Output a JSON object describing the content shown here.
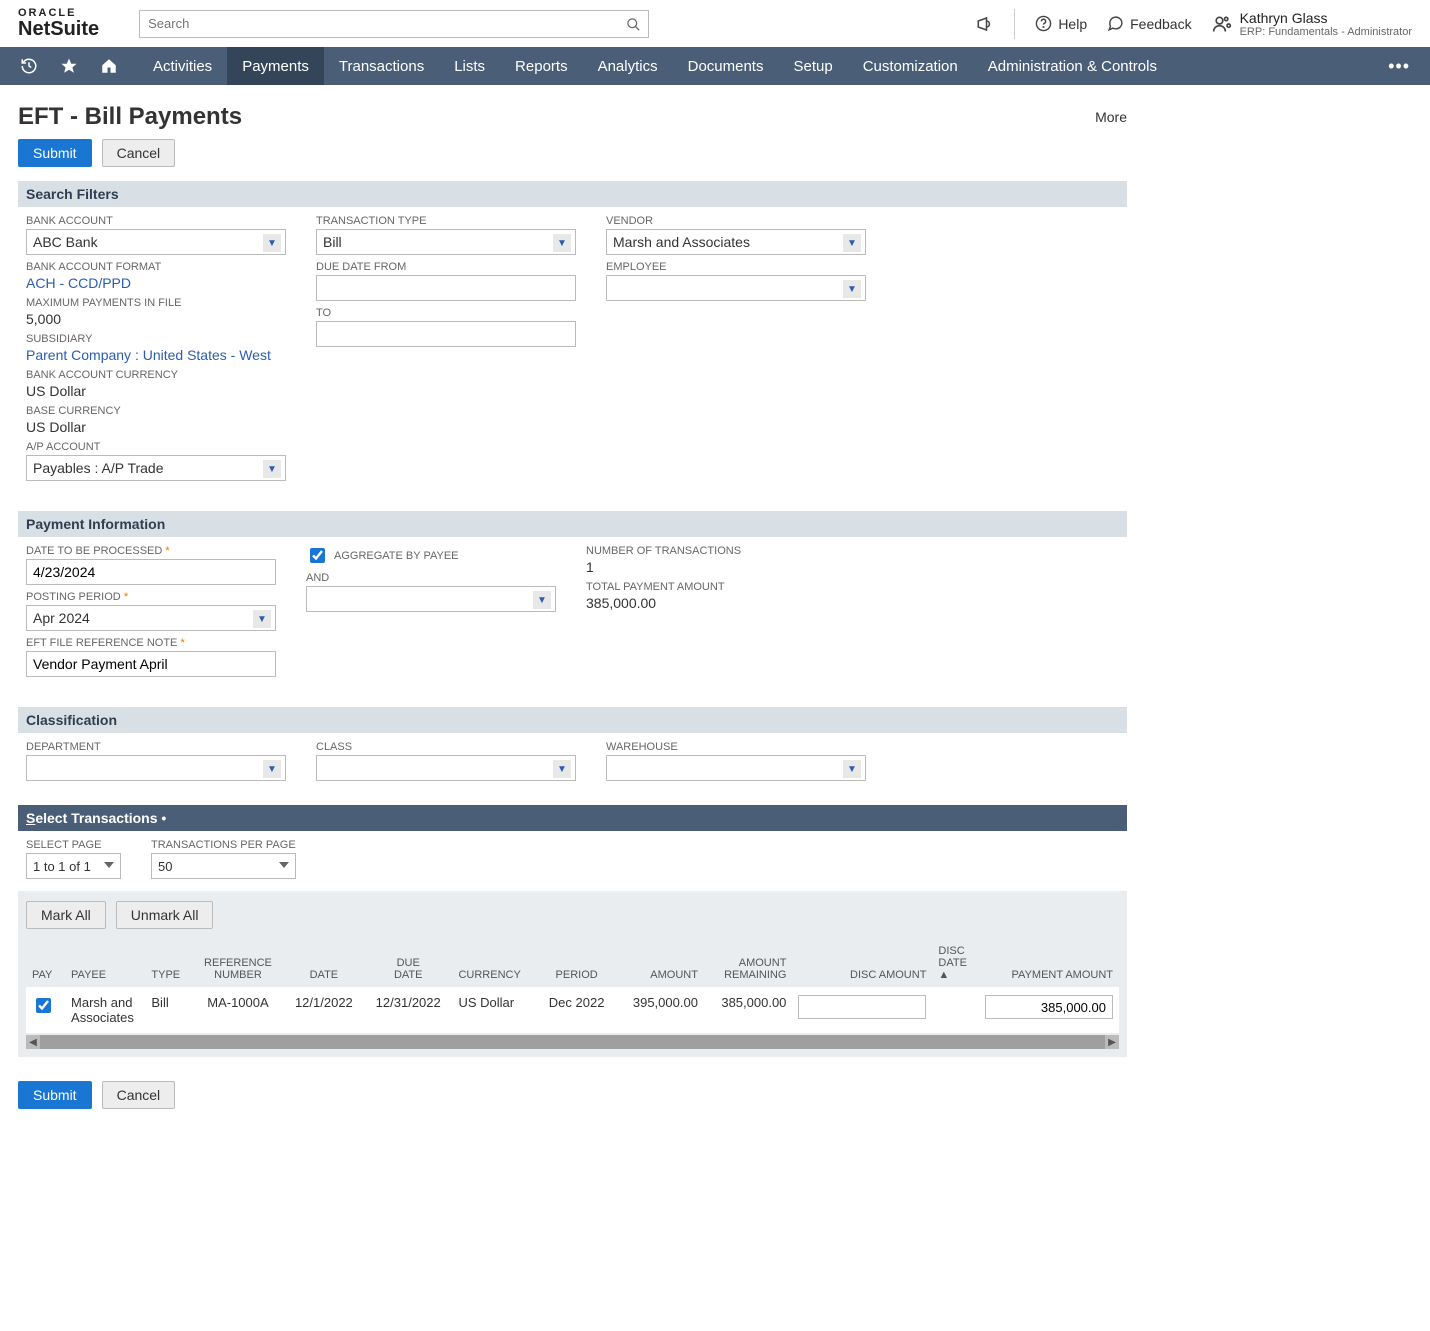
{
  "header": {
    "logo_line1": "ORACLE",
    "logo_line2": "NetSuite",
    "search_placeholder": "Search",
    "help": "Help",
    "feedback": "Feedback",
    "user_name": "Kathryn Glass",
    "user_role": "ERP: Fundamentals - Administrator"
  },
  "nav": {
    "items": [
      "Activities",
      "Payments",
      "Transactions",
      "Lists",
      "Reports",
      "Analytics",
      "Documents",
      "Setup",
      "Customization",
      "Administration & Controls"
    ],
    "active_index": 1
  },
  "page": {
    "title": "EFT - Bill Payments",
    "more": "More",
    "submit": "Submit",
    "cancel": "Cancel"
  },
  "sections": {
    "search_filters": "Search Filters",
    "payment_info": "Payment Information",
    "classification": "Classification",
    "select_transactions": "Select Transactions"
  },
  "filters": {
    "bank_account_label": "BANK ACCOUNT",
    "bank_account": "ABC Bank",
    "bank_account_format_label": "BANK ACCOUNT FORMAT",
    "bank_account_format": "ACH - CCD/PPD",
    "max_payments_label": "MAXIMUM PAYMENTS IN FILE",
    "max_payments": "5,000",
    "subsidiary_label": "SUBSIDIARY",
    "subsidiary": "Parent Company : United States - West",
    "bank_currency_label": "BANK ACCOUNT CURRENCY",
    "bank_currency": "US Dollar",
    "base_currency_label": "BASE CURRENCY",
    "base_currency": "US Dollar",
    "ap_account_label": "A/P ACCOUNT",
    "ap_account": "Payables : A/P Trade",
    "transaction_type_label": "TRANSACTION TYPE",
    "transaction_type": "Bill",
    "due_date_from_label": "DUE DATE FROM",
    "due_date_from": "",
    "to_label": "TO",
    "to": "",
    "vendor_label": "VENDOR",
    "vendor": "Marsh and Associates",
    "employee_label": "EMPLOYEE",
    "employee": ""
  },
  "payment": {
    "date_to_be_processed_label": "DATE TO BE PROCESSED",
    "date_to_be_processed": "4/23/2024",
    "posting_period_label": "POSTING PERIOD",
    "posting_period": "Apr 2024",
    "eft_ref_label": "EFT FILE REFERENCE NOTE",
    "eft_ref": "Vendor Payment April",
    "aggregate_label": "AGGREGATE BY PAYEE",
    "aggregate_checked": true,
    "and_label": "AND",
    "and_value": "",
    "num_transactions_label": "NUMBER OF TRANSACTIONS",
    "num_transactions": "1",
    "total_amount_label": "TOTAL PAYMENT AMOUNT",
    "total_amount": "385,000.00"
  },
  "classification": {
    "department_label": "DEPARTMENT",
    "department": "",
    "class_label": "CLASS",
    "class": "",
    "warehouse_label": "WAREHOUSE",
    "warehouse": ""
  },
  "transactions": {
    "select_page_label": "SELECT PAGE",
    "select_page": "1 to 1 of 1",
    "per_page_label": "TRANSACTIONS PER PAGE",
    "per_page": "50",
    "mark_all": "Mark All",
    "unmark_all": "Unmark All",
    "columns": {
      "pay": "PAY",
      "payee": "PAYEE",
      "type": "TYPE",
      "ref": "REFERENCE\nNUMBER",
      "date": "DATE",
      "due_date": "DUE\nDATE",
      "currency": "CURRENCY",
      "period": "PERIOD",
      "amount": "AMOUNT",
      "amount_remaining": "AMOUNT\nREMAINING",
      "disc_amount": "DISC AMOUNT",
      "disc_date": "DISC\nDATE",
      "payment_amount": "PAYMENT AMOUNT"
    },
    "rows": [
      {
        "pay": true,
        "payee": "Marsh and Associates",
        "type": "Bill",
        "ref": "MA-1000A",
        "date": "12/1/2022",
        "due_date": "12/31/2022",
        "currency": "US Dollar",
        "period": "Dec 2022",
        "amount": "395,000.00",
        "amount_remaining": "385,000.00",
        "disc_amount": "",
        "disc_date": "",
        "payment_amount": "385,000.00"
      }
    ]
  }
}
